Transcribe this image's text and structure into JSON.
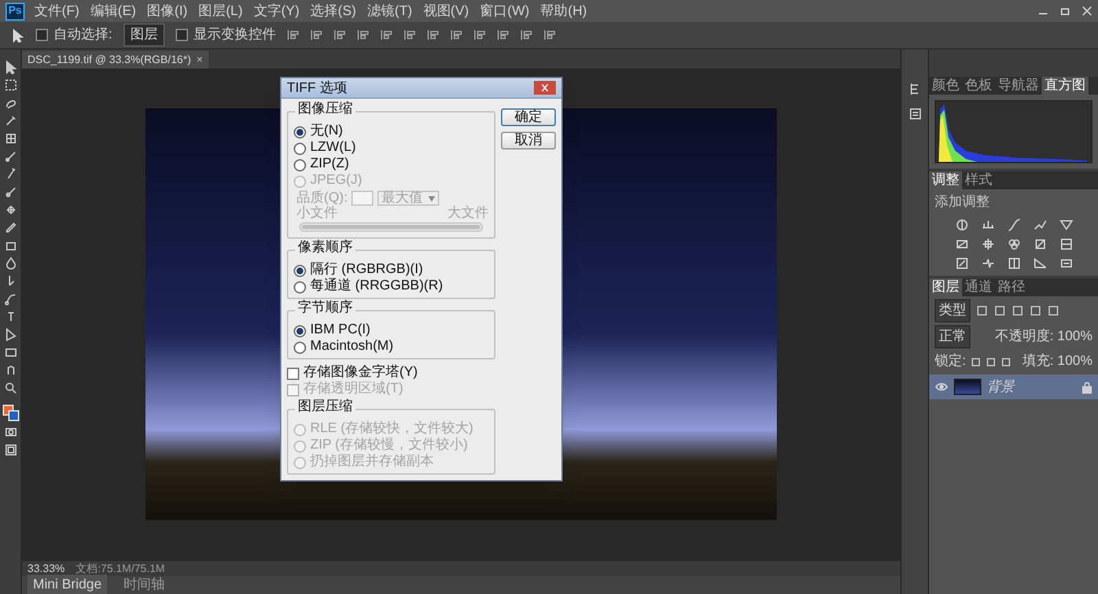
{
  "app": {
    "logo": "Ps"
  },
  "menu": [
    "文件(F)",
    "编辑(E)",
    "图像(I)",
    "图层(L)",
    "文字(Y)",
    "选择(S)",
    "滤镜(T)",
    "视图(V)",
    "窗口(W)",
    "帮助(H)"
  ],
  "options_bar": {
    "auto_select": {
      "label": "自动选择:",
      "checked": false
    },
    "target": "图层",
    "show_transform": {
      "label": "显示变换控件",
      "checked": false
    }
  },
  "document_tab": {
    "title": "DSC_1199.tif @ 33.3%(RGB/16*)",
    "close": "×"
  },
  "dialog": {
    "title": "TIFF 选项",
    "buttons": [
      "确定",
      "取消"
    ],
    "image_compression": {
      "legend": "图像压缩",
      "options": [
        {
          "label": "无(N)",
          "selected": true,
          "disabled": false
        },
        {
          "label": "LZW(L)",
          "selected": false,
          "disabled": false
        },
        {
          "label": "ZIP(Z)",
          "selected": false,
          "disabled": false
        },
        {
          "label": "JPEG(J)",
          "selected": false,
          "disabled": true
        }
      ],
      "quality": {
        "label": "品质(Q):",
        "value": "最大值",
        "low": "小文件",
        "high": "大文件",
        "disabled": true,
        "level": 1
      }
    },
    "pixel_order": {
      "legend": "像素顺序",
      "options": [
        {
          "label": "隔行 (RGBRGB)(I)",
          "selected": true,
          "disabled": false
        },
        {
          "label": "每通道 (RRGGBB)(R)",
          "selected": false,
          "disabled": false
        }
      ]
    },
    "byte_order": {
      "legend": "字节顺序",
      "options": [
        {
          "label": "IBM PC(I)",
          "selected": true,
          "disabled": false
        },
        {
          "label": "Macintosh(M)",
          "selected": false,
          "disabled": false
        }
      ]
    },
    "checkboxes": [
      {
        "label": "存储图像金字塔(Y)",
        "checked": false,
        "disabled": false
      },
      {
        "label": "存储透明区域(T)",
        "checked": false,
        "disabled": true
      }
    ],
    "layer_compression": {
      "legend": "图层压缩",
      "options": [
        {
          "label": "RLE (存储较快，文件较大)",
          "selected": false,
          "disabled": true
        },
        {
          "label": "ZIP (存储较慢，文件较小)",
          "selected": false,
          "disabled": true
        },
        {
          "label": "扔掉图层并存储副本",
          "selected": false,
          "disabled": true
        }
      ]
    }
  },
  "status_bar": {
    "zoom": "33.33%",
    "document": "文档:75.1M/75.1M"
  },
  "bottom_tabs": [
    "Mini Bridge",
    "时间轴"
  ],
  "panels": {
    "histogram": {
      "tabs": [
        {
          "label": "颜色",
          "selected": false
        },
        {
          "label": "色板",
          "selected": false
        },
        {
          "label": "导航器",
          "selected": false
        },
        {
          "label": "直方图",
          "selected": true
        }
      ]
    },
    "adjustments": {
      "tabs": [
        {
          "label": "调整",
          "selected": true
        },
        {
          "label": "样式",
          "selected": false
        }
      ],
      "heading": "添加调整"
    },
    "layers": {
      "tabs": [
        {
          "label": "图层",
          "selected": true
        },
        {
          "label": "通道",
          "selected": false
        },
        {
          "label": "路径",
          "selected": false
        }
      ],
      "filter": "类型",
      "blend_mode": "正常",
      "opacity": "不透明度: 100%",
      "lock": "锁定:",
      "fill": "填充: 100%",
      "items": [
        {
          "name": "背景",
          "visible": true,
          "selected": true,
          "locked": true
        }
      ]
    }
  }
}
